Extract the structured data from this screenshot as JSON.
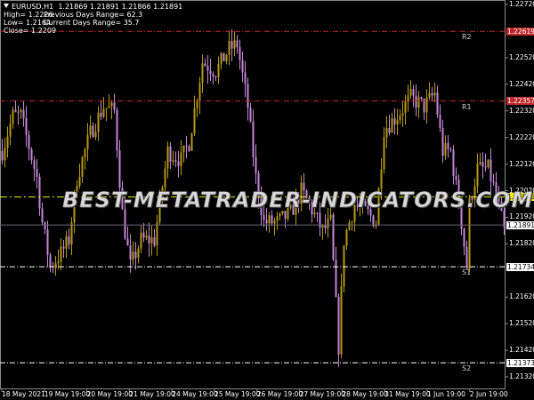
{
  "header": {
    "symbol": "EURUSD,H1",
    "ohlc": "1.21869 1.21891 1.21866 1.21891",
    "high": "High= 1.2226",
    "low": "Low= 1.2164",
    "close": "Close= 1.2209",
    "prev_range": "Previous Days Range= 62.3",
    "curr_range": "Current Days Range= 35.7"
  },
  "watermark": "BEST-METATRADER-INDICATORS.COM",
  "colors": {
    "bull": "#b59a10",
    "bear": "#c487d8",
    "resistance": "#c0282c",
    "pivot": "#f0f000",
    "support": "#ffffff",
    "current": "#ffffff"
  },
  "levels": [
    {
      "name": "R2",
      "price": 1.22619,
      "label": "1.22619",
      "kind": "resistance"
    },
    {
      "name": "R1",
      "price": 1.22357,
      "label": "1.22357",
      "kind": "resistance"
    },
    {
      "name": "",
      "price": 1.21996,
      "label": "1.21996",
      "kind": "pivot"
    },
    {
      "name": "",
      "price": 1.21891,
      "label": "1.21891",
      "kind": "current"
    },
    {
      "name": "S1",
      "price": 1.21734,
      "label": "1.21734",
      "kind": "support"
    },
    {
      "name": "S2",
      "price": 1.21373,
      "label": "1.21373",
      "kind": "support"
    }
  ],
  "chart_data": {
    "type": "candlestick",
    "ylim": [
      1.213,
      1.2274
    ],
    "price_ticks": [
      "1.22720",
      "1.22520",
      "1.22420",
      "1.22320",
      "1.22220",
      "1.22120",
      "1.22020",
      "1.21920",
      "1.21820",
      "1.21620",
      "1.21520",
      "1.21420",
      "1.21320"
    ],
    "time_ticks": [
      "18 May 2021",
      "19 May 19:00",
      "20 May 19:00",
      "21 May 19:00",
      "24 May 19:00",
      "25 May 19:00",
      "26 May 19:00",
      "27 May 19:00",
      "28 May 19:00",
      "31 May 19:00",
      "1 Jun 19:00",
      "2 Jun 19:00"
    ],
    "path": [
      [
        0,
        1.22169
      ],
      [
        4,
        1.22302
      ],
      [
        7,
        1.22302
      ],
      [
        13,
        1.22068
      ],
      [
        15,
        1.21901
      ],
      [
        18,
        1.21734
      ],
      [
        22,
        1.21784
      ],
      [
        25,
        1.21835
      ],
      [
        28,
        1.22068
      ],
      [
        33,
        1.22236
      ],
      [
        38,
        1.22336
      ],
      [
        42,
        1.22319
      ],
      [
        45,
        1.21935
      ],
      [
        48,
        1.21734
      ],
      [
        52,
        1.21835
      ],
      [
        57,
        1.21835
      ],
      [
        62,
        1.22169
      ],
      [
        67,
        1.22135
      ],
      [
        70,
        1.22202
      ],
      [
        75,
        1.22503
      ],
      [
        80,
        1.22469
      ],
      [
        85,
        1.22553
      ],
      [
        88,
        1.2257
      ],
      [
        92,
        1.22336
      ],
      [
        95,
        1.22068
      ],
      [
        98,
        1.21901
      ],
      [
        103,
        1.21901
      ],
      [
        108,
        1.21935
      ],
      [
        112,
        1.22018
      ],
      [
        115,
        1.21968
      ],
      [
        120,
        1.21868
      ],
      [
        123,
        1.21901
      ],
      [
        126,
        1.21434
      ],
      [
        128,
        1.21835
      ],
      [
        132,
        1.21968
      ],
      [
        137,
        1.21935
      ],
      [
        140,
        1.21901
      ],
      [
        143,
        1.22252
      ],
      [
        148,
        1.22302
      ],
      [
        153,
        1.22369
      ],
      [
        158,
        1.22336
      ],
      [
        162,
        1.22386
      ],
      [
        165,
        1.22169
      ],
      [
        168,
        1.22169
      ],
      [
        172,
        1.21901
      ],
      [
        174,
        1.21734
      ],
      [
        175,
        1.21968
      ],
      [
        178,
        1.22102
      ],
      [
        182,
        1.22102
      ],
      [
        185,
        1.22002
      ],
      [
        188,
        1.21868
      ]
    ]
  }
}
